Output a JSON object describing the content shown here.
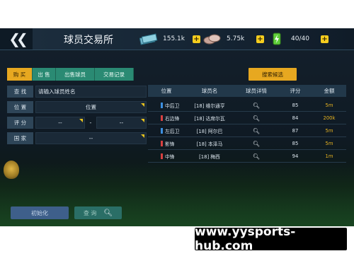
{
  "header": {
    "title": "球员交易所",
    "currencies": [
      {
        "icon": "cash-stack-icon",
        "value": "155.1k"
      },
      {
        "icon": "coins-icon",
        "value": "5.75k"
      },
      {
        "icon": "energy-battery-icon",
        "value": "40/40"
      }
    ],
    "plus_label": "+"
  },
  "tabs": [
    {
      "label": "购 买",
      "active": true
    },
    {
      "label": "出 售",
      "active": false
    },
    {
      "label": "出售球员",
      "active": false
    },
    {
      "label": "交易记录",
      "active": false
    }
  ],
  "search_button": "搜索候选",
  "filters": {
    "search": {
      "label": "查 找",
      "placeholder": "请输入球员姓名"
    },
    "position": {
      "label": "位 置",
      "value": "位置"
    },
    "rating": {
      "label": "评 分",
      "min": "--",
      "sep": "-",
      "max": "--"
    },
    "country": {
      "label": "国 家",
      "value": "--"
    }
  },
  "table": {
    "headers": [
      "位置",
      "球员名",
      "球员详情",
      "评分",
      "金额"
    ],
    "rows": [
      {
        "position": "中后卫",
        "pos_color": "#3d8fe0",
        "name": "[18] 维尔通亨",
        "rating": "85",
        "price": "5m"
      },
      {
        "position": "右边锋",
        "pos_color": "#d84040",
        "name": "[18] 达席尔瓦",
        "rating": "84",
        "price": "200k"
      },
      {
        "position": "左后卫",
        "pos_color": "#3d8fe0",
        "name": "[18] 阿尔巴",
        "rating": "87",
        "price": "5m"
      },
      {
        "position": "影锋",
        "pos_color": "#d84040",
        "name": "[18] 本泽马",
        "rating": "85",
        "price": "5m"
      },
      {
        "position": "中锋",
        "pos_color": "#d84040",
        "name": "[18] 梅西",
        "rating": "94",
        "price": "1m"
      }
    ]
  },
  "buttons": {
    "reset": "初始化",
    "go": "查 询"
  },
  "watermark": "www.yysports-hub.com",
  "colors": {
    "accent": "#e7a820",
    "tab": "#2a8a73",
    "price": "#e8b420"
  }
}
